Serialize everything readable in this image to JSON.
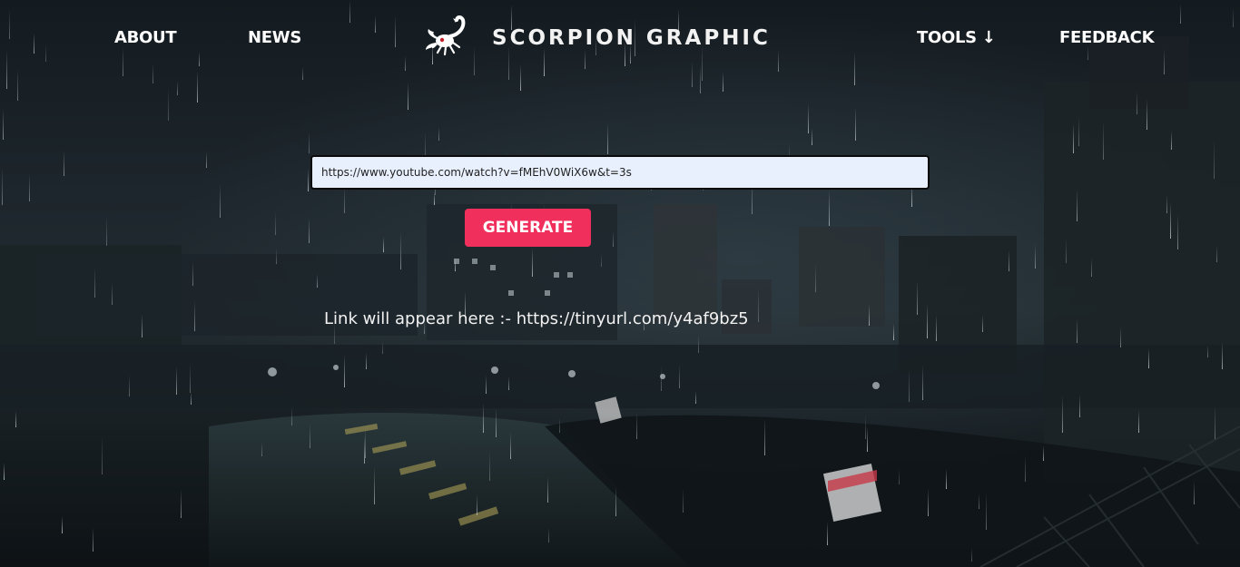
{
  "nav": {
    "about": "ABOUT",
    "news": "NEWS",
    "tools": "TOOLS ↓",
    "feedback": "FEEDBACK"
  },
  "brand": {
    "name": "SCORPION GRAPHIC",
    "logo_icon": "scorpion-icon"
  },
  "form": {
    "url_value": "https://www.youtube.com/watch?v=fMEhV0WiX6w&t=3s",
    "generate_label": "GENERATE"
  },
  "result": {
    "prefix": "Link will appear here :- ",
    "link": "https://tinyurl.com/y4af9bz5"
  },
  "colors": {
    "accent": "#f12f5c",
    "input_bg": "#e8f0fe",
    "text": "#ffffff"
  }
}
